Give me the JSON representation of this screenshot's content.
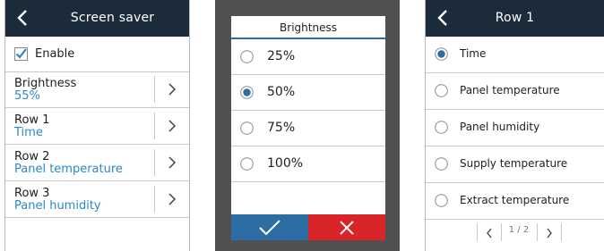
{
  "screen_saver": {
    "title": "Screen saver",
    "enable_label": "Enable",
    "enable_checked": true,
    "items": [
      {
        "label": "Brightness",
        "value": "55%"
      },
      {
        "label": "Row 1",
        "value": "Time"
      },
      {
        "label": "Row 2",
        "value": "Panel temperature"
      },
      {
        "label": "Row 3",
        "value": "Panel humidity"
      }
    ]
  },
  "brightness_dialog": {
    "title": "Brightness",
    "options": [
      "25%",
      "50%",
      "75%",
      "100%"
    ],
    "selected": "50%",
    "ok_icon": "checkmark-icon",
    "cancel_icon": "close-icon"
  },
  "row1": {
    "title": "Row 1",
    "options": [
      "Time",
      "Panel temperature",
      "Panel humidity",
      "Supply temperature",
      "Extract temperature"
    ],
    "selected": "Time",
    "pager": "1 / 2"
  },
  "colors": {
    "header": "#1c2b3a",
    "value_blue": "#2b8ac4",
    "ok_blue": "#2c6ea3",
    "cancel_red": "#d9252a",
    "overlay": "#505050"
  }
}
